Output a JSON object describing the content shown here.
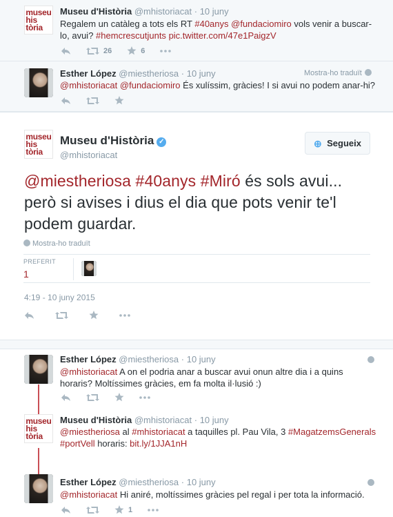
{
  "tweets_top": [
    {
      "name": "Museu d'Història",
      "handle": "@mhistoriacat",
      "date": "· 10 juny",
      "text_parts": [
        {
          "t": "Regalem un catàleg a tots els RT ",
          "link": false
        },
        {
          "t": "#40anys",
          "link": true
        },
        {
          "t": " ",
          "link": false
        },
        {
          "t": "@fundaciomiro",
          "link": true
        },
        {
          "t": "  vols venir a buscar-lo, avui? ",
          "link": false
        },
        {
          "t": "#hemcrescutjunts",
          "link": true
        },
        {
          "t": " ",
          "link": false
        },
        {
          "t": "pic.twitter.com/47e1PaigzV",
          "link": true
        }
      ],
      "retweets": "26",
      "favorites": "6"
    },
    {
      "name": "Esther López",
      "handle": "@miestheriosa",
      "date": "· 10 juny",
      "translate": "Mostra-ho traduït",
      "text_parts": [
        {
          "t": "@mhistoriacat",
          "link": true
        },
        {
          "t": " ",
          "link": false
        },
        {
          "t": "@fundaciomiro",
          "link": true
        },
        {
          "t": " És xulíssim, gràcies! I si avui no podem anar-hi?",
          "link": false
        }
      ]
    }
  ],
  "logo_text": [
    "museu",
    "his",
    "tòria"
  ],
  "main": {
    "name": "Museu d'Història",
    "handle": "@mhistoriacat",
    "verified_glyph": "✓",
    "follow_label": "Segueix",
    "text_parts": [
      {
        "t": "@miestheriosa",
        "link": true
      },
      {
        "t": " ",
        "link": false
      },
      {
        "t": "#40anys",
        "link": true
      },
      {
        "t": " ",
        "link": false
      },
      {
        "t": "#Miró",
        "link": true
      },
      {
        "t": " és sols avui... però si avises i dius el dia que pots venir te'l podem guardar.",
        "link": false
      }
    ],
    "translate": "Mostra-ho traduït",
    "favorited_label": "PREFERIT",
    "favorited_count": "1",
    "timestamp": "4:19 - 10 juny 2015"
  },
  "replies": [
    {
      "name": "Esther López",
      "handle": "@miestheriosa",
      "date": "· 10 juny",
      "text_parts": [
        {
          "t": "@mhistoriacat",
          "link": true
        },
        {
          "t": " A on el podria anar a buscar avui onun altre dia i a quins horaris? Moltíssimes gràcies, em fa molta il·lusió :)",
          "link": false
        }
      ]
    },
    {
      "name": "Museu d'Història",
      "handle": "@mhistoriacat",
      "date": "· 10 juny",
      "text_parts": [
        {
          "t": "@miestheriosa",
          "link": true
        },
        {
          "t": " al ",
          "link": false
        },
        {
          "t": "#mhistoriacat",
          "link": true
        },
        {
          "t": " a taquilles pl. Pau Vila, 3 ",
          "link": false
        },
        {
          "t": "#MagatzemsGenerals",
          "link": true
        },
        {
          "t": " ",
          "link": false
        },
        {
          "t": "#portVell",
          "link": true
        },
        {
          "t": " horaris: ",
          "link": false
        },
        {
          "t": "bit.ly/1JJA1nH",
          "link": true
        }
      ]
    },
    {
      "name": "Esther López",
      "handle": "@miestheriosa",
      "date": "· 10 juny",
      "text_parts": [
        {
          "t": "@mhistoriacat",
          "link": true
        },
        {
          "t": " Hi aniré, moltíssimes gràcies pel regal i per tota la informació.",
          "link": false
        }
      ],
      "favorites": "1"
    }
  ],
  "colors": {
    "accent": "#a3262b",
    "verified": "#55acee",
    "muted": "#8899a6"
  },
  "icons": [
    "reply-icon",
    "retweet-icon",
    "favorite-icon",
    "more-icon",
    "globe-icon",
    "follow-icon"
  ]
}
